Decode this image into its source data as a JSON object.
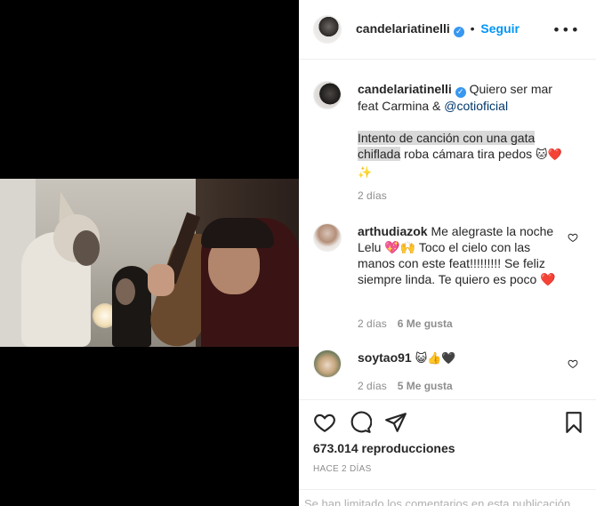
{
  "post": {
    "username": "candelariatinelli",
    "follow_label": "Seguir",
    "more_label": "•••"
  },
  "caption": {
    "username": "candelariatinelli",
    "text_part1": "Quiero ser mar feat Carmina &",
    "mention": "@cotioficial",
    "highlight_text": "Intento de canción con una gata chiflada",
    "text_part2": "roba cámara tira pedos",
    "emojis": "🐱❤️✨",
    "time": "2 días"
  },
  "comments": [
    {
      "username": "arthudiazok",
      "text": "Me alegraste la noche Lelu 💖🙌 Toco el cielo con las manos con este feat!!!!!!!!! Se feliz siempre linda. Te quiero es poco ❤️",
      "time": "2 días",
      "likes": "6 Me gusta"
    },
    {
      "username": "soytao91",
      "text": "😺👍🖤",
      "time": "2 días",
      "likes": "5 Me gusta"
    }
  ],
  "stats": {
    "views": "673.014 reproducciones",
    "posted_ago": "HACE 2 DÍAS",
    "comments_limited": "Se han limitado los comentarios en esta publicación."
  },
  "icons": {
    "like": "heart-icon",
    "comment": "comment-icon",
    "share": "share-icon",
    "save": "bookmark-icon",
    "verified": "verified-badge-icon"
  },
  "colors": {
    "link": "#0095f6",
    "verified": "#3897f0",
    "meta": "#8e8e8e",
    "heart_red": "#ed4956"
  }
}
